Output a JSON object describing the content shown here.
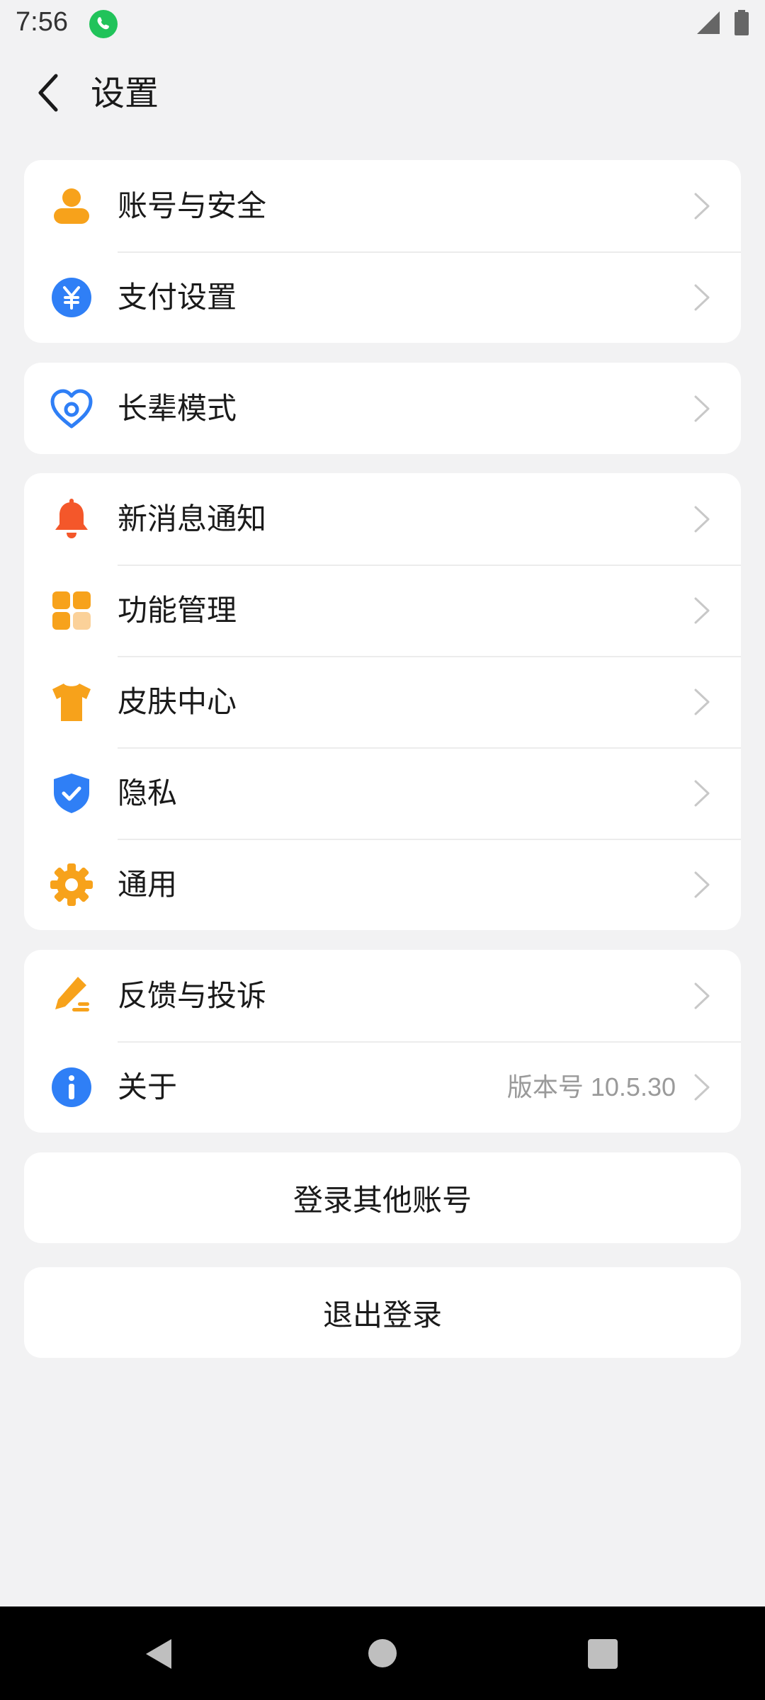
{
  "status_bar": {
    "time": "7:56",
    "icons": [
      "phone-call-icon",
      "signal-icon",
      "battery-icon"
    ]
  },
  "header": {
    "title": "设置",
    "back_icon": "chevron-left-icon"
  },
  "groups": [
    {
      "items": [
        {
          "label": "账号与安全",
          "icon": "person-icon",
          "color": "#f7a21b"
        },
        {
          "label": "支付设置",
          "icon": "yuan-icon",
          "color": "#2f7ff6"
        }
      ]
    },
    {
      "items": [
        {
          "label": "长辈模式",
          "icon": "heart-icon",
          "color": "#2f7ff6"
        }
      ]
    },
    {
      "items": [
        {
          "label": "新消息通知",
          "icon": "bell-icon",
          "color": "#f4572a"
        },
        {
          "label": "功能管理",
          "icon": "grid-icon",
          "color": "#f7a21b"
        },
        {
          "label": "皮肤中心",
          "icon": "shirt-icon",
          "color": "#f7a21b"
        },
        {
          "label": "隐私",
          "icon": "shield-icon",
          "color": "#2f7ff6"
        },
        {
          "label": "通用",
          "icon": "gear-icon",
          "color": "#f7a21b"
        }
      ]
    },
    {
      "items": [
        {
          "label": "反馈与投诉",
          "icon": "pencil-icon",
          "color": "#f7a21b"
        },
        {
          "label": "关于",
          "icon": "info-icon",
          "color": "#2f7ff6",
          "value": "版本号 10.5.30"
        }
      ]
    }
  ],
  "actions": {
    "switch_account": "登录其他账号",
    "logout": "退出登录"
  },
  "nav_bar": {
    "icons": [
      "nav-back-icon",
      "nav-home-icon",
      "nav-recents-icon"
    ]
  },
  "colors": {
    "background": "#f2f2f3",
    "card": "#ffffff",
    "orange": "#f7a21b",
    "blue": "#2f7ff6",
    "red": "#f4572a",
    "secondary_text": "#9a9a9a"
  }
}
